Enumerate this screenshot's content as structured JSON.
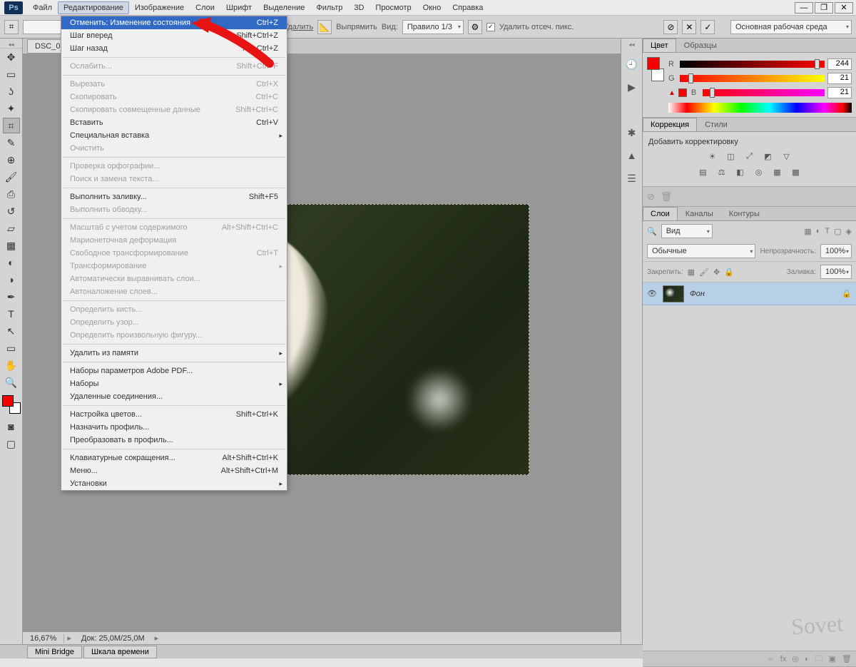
{
  "menubar": {
    "items": [
      "Файл",
      "Редактирование",
      "Изображение",
      "Слои",
      "Шрифт",
      "Выделение",
      "Фильтр",
      "3D",
      "Просмотр",
      "Окно",
      "Справка"
    ],
    "active_index": 1
  },
  "options": {
    "clear_label": "Удалить",
    "straighten_label": "Выпрямить",
    "view_label": "Вид:",
    "view_value": "Правило 1/3",
    "delete_cropped": "Удалить отсеч. пикс.",
    "workspace": "Основная рабочая среда"
  },
  "document": {
    "tab": "DSC_0…",
    "zoom": "16,67%",
    "info": "Док: 25,0M/25,0M"
  },
  "edit_menu": {
    "items": [
      {
        "label": "Отменить: Изменение состояния",
        "short": "Ctrl+Z",
        "hl": true
      },
      {
        "label": "Шаг вперед",
        "short": "Shift+Ctrl+Z"
      },
      {
        "label": "Шаг назад",
        "short": "Alt+Ctrl+Z"
      },
      {
        "sep": true
      },
      {
        "label": "Ослабить...",
        "short": "Shift+Ctrl+F",
        "disabled": true
      },
      {
        "sep": true
      },
      {
        "label": "Вырезать",
        "short": "Ctrl+X",
        "disabled": true
      },
      {
        "label": "Скопировать",
        "short": "Ctrl+C",
        "disabled": true
      },
      {
        "label": "Скопировать совмещенные данные",
        "short": "Shift+Ctrl+C",
        "disabled": true
      },
      {
        "label": "Вставить",
        "short": "Ctrl+V"
      },
      {
        "label": "Специальная вставка",
        "sub": true
      },
      {
        "label": "Очистить",
        "disabled": true
      },
      {
        "sep": true
      },
      {
        "label": "Проверка орфографии...",
        "disabled": true
      },
      {
        "label": "Поиск и замена текста...",
        "disabled": true
      },
      {
        "sep": true
      },
      {
        "label": "Выполнить заливку...",
        "short": "Shift+F5"
      },
      {
        "label": "Выполнить обводку...",
        "disabled": true
      },
      {
        "sep": true
      },
      {
        "label": "Масштаб с учетом содержимого",
        "short": "Alt+Shift+Ctrl+C",
        "disabled": true
      },
      {
        "label": "Марионеточная деформация",
        "disabled": true
      },
      {
        "label": "Свободное трансформирование",
        "short": "Ctrl+T",
        "disabled": true
      },
      {
        "label": "Трансформирование",
        "sub": true,
        "disabled": true
      },
      {
        "label": "Автоматически выравнивать слои...",
        "disabled": true
      },
      {
        "label": "Автоналожение слоев...",
        "disabled": true
      },
      {
        "sep": true
      },
      {
        "label": "Определить кисть...",
        "disabled": true
      },
      {
        "label": "Определить узор...",
        "disabled": true
      },
      {
        "label": "Определить произвольную фигуру...",
        "disabled": true
      },
      {
        "sep": true
      },
      {
        "label": "Удалить из памяти",
        "sub": true
      },
      {
        "sep": true
      },
      {
        "label": "Наборы параметров Adobe PDF..."
      },
      {
        "label": "Наборы",
        "sub": true
      },
      {
        "label": "Удаленные соединения..."
      },
      {
        "sep": true
      },
      {
        "label": "Настройка цветов...",
        "short": "Shift+Ctrl+K"
      },
      {
        "label": "Назначить профиль..."
      },
      {
        "label": "Преобразовать в профиль..."
      },
      {
        "sep": true
      },
      {
        "label": "Клавиатурные сокращения...",
        "short": "Alt+Shift+Ctrl+K"
      },
      {
        "label": "Меню...",
        "short": "Alt+Shift+Ctrl+M"
      },
      {
        "label": "Установки",
        "sub": true
      }
    ]
  },
  "color_panel": {
    "tabs": [
      "Цвет",
      "Образцы"
    ],
    "r": "244",
    "g": "21",
    "b": "21"
  },
  "adjust_panel": {
    "tabs": [
      "Коррекция",
      "Стили"
    ],
    "title": "Добавить корректировку"
  },
  "layers_panel": {
    "tabs": [
      "Слои",
      "Каналы",
      "Контуры"
    ],
    "kind": "Вид",
    "blend": "Обычные",
    "opacity_label": "Непрозрачность:",
    "opacity": "100%",
    "lock_label": "Закрепить:",
    "fill_label": "Заливка:",
    "fill": "100%",
    "layer_name": "Фон"
  },
  "bottom_tabs": [
    "Mini Bridge",
    "Шкала времени"
  ],
  "watermark": "Sovet"
}
